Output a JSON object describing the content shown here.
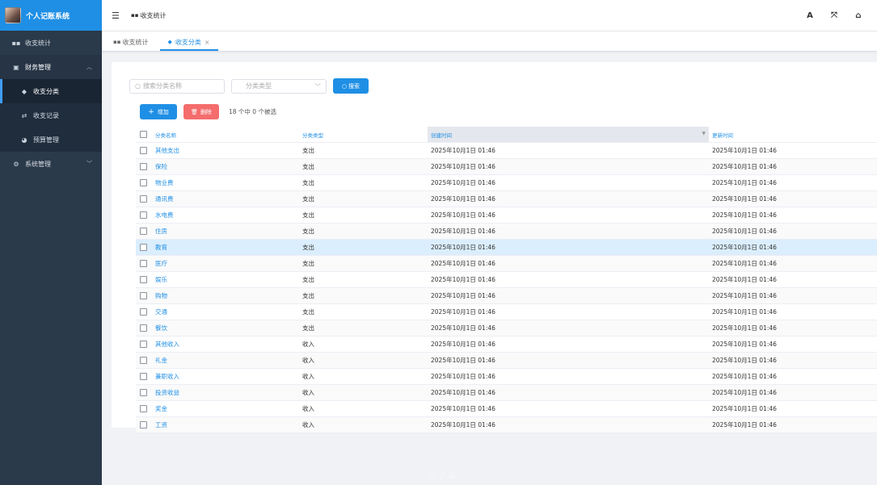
{
  "sidebar": {
    "app_title": "个人记账系统",
    "items": [
      {
        "label": "收支统计",
        "icon": "grid-icon"
      },
      {
        "label": "财务管理",
        "icon": "wallet-icon"
      },
      {
        "label": "收支分类",
        "icon": "tag-icon"
      },
      {
        "label": "收支记录",
        "icon": "exchange-icon"
      },
      {
        "label": "预算管理",
        "icon": "pie-icon"
      },
      {
        "label": "系统管理",
        "icon": "gears-icon"
      }
    ]
  },
  "header": {
    "breadcrumb": "收支统计",
    "icons": [
      "font-size-icon",
      "fullscreen-icon",
      "home-icon"
    ]
  },
  "tabs": [
    {
      "label": "收支统计",
      "active": false
    },
    {
      "label": "收支分类",
      "active": true
    }
  ],
  "filters": {
    "name_placeholder": "搜索分类名称",
    "type_placeholder": "分类类型",
    "search_label": "搜索"
  },
  "actions": {
    "add_label": "增加",
    "delete_label": "删除",
    "selection_info": "18 个中 0 个被选"
  },
  "table": {
    "headers": [
      "分类名称",
      "分类类型",
      "创建时间",
      "更新时间"
    ],
    "rows": [
      [
        "其他支出",
        "支出",
        "2025年10月1日 01:46",
        "2025年10月1日 01:46"
      ],
      [
        "保险",
        "支出",
        "2025年10月1日 01:46",
        "2025年10月1日 01:46"
      ],
      [
        "物业费",
        "支出",
        "2025年10月1日 01:46",
        "2025年10月1日 01:46"
      ],
      [
        "通讯费",
        "支出",
        "2025年10月1日 01:46",
        "2025年10月1日 01:46"
      ],
      [
        "水电费",
        "支出",
        "2025年10月1日 01:46",
        "2025年10月1日 01:46"
      ],
      [
        "住房",
        "支出",
        "2025年10月1日 01:46",
        "2025年10月1日 01:46"
      ],
      [
        "教育",
        "支出",
        "2025年10月1日 01:46",
        "2025年10月1日 01:46"
      ],
      [
        "医疗",
        "支出",
        "2025年10月1日 01:46",
        "2025年10月1日 01:46"
      ],
      [
        "娱乐",
        "支出",
        "2025年10月1日 01:46",
        "2025年10月1日 01:46"
      ],
      [
        "购物",
        "支出",
        "2025年10月1日 01:46",
        "2025年10月1日 01:46"
      ],
      [
        "交通",
        "支出",
        "2025年10月1日 01:46",
        "2025年10月1日 01:46"
      ],
      [
        "餐饮",
        "支出",
        "2025年10月1日 01:46",
        "2025年10月1日 01:46"
      ],
      [
        "其他收入",
        "收入",
        "2025年10月1日 01:46",
        "2025年10月1日 01:46"
      ],
      [
        "礼金",
        "收入",
        "2025年10月1日 01:46",
        "2025年10月1日 01:46"
      ],
      [
        "兼职收入",
        "收入",
        "2025年10月1日 01:46",
        "2025年10月1日 01:46"
      ],
      [
        "投资收益",
        "收入",
        "2025年10月1日 01:46",
        "2025年10月1日 01:46"
      ],
      [
        "奖金",
        "收入",
        "2025年10月1日 01:46",
        "2025年10月1日 01:46"
      ],
      [
        "工资",
        "收入",
        "2025年10月1日 01:46",
        "2025年10月1日 01:46"
      ]
    ]
  },
  "page_indicator": "3 / 4",
  "colors": {
    "accent": "#1f8fe5",
    "danger": "#f56c6c",
    "sidebar": "#2b3a4b"
  }
}
